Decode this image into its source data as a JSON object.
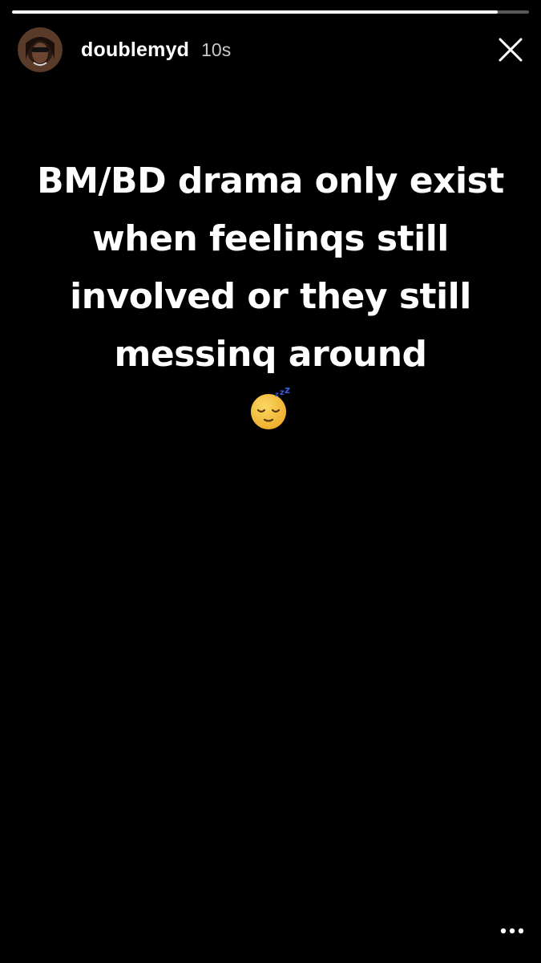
{
  "story": {
    "progress": 0.94,
    "username": "doublemyd",
    "timestamp": "10s",
    "text": "BM/BD drama only exist when feelinqs still involved or they still messinq around",
    "emoji": "sleeping-face"
  },
  "icons": {
    "close": "close-icon",
    "more": "more-options-icon",
    "avatar": "profile-avatar"
  },
  "colors": {
    "background": "#000000",
    "text": "#ffffff",
    "progress_track": "rgba(255,255,255,0.35)",
    "progress_fill": "#ffffff"
  }
}
